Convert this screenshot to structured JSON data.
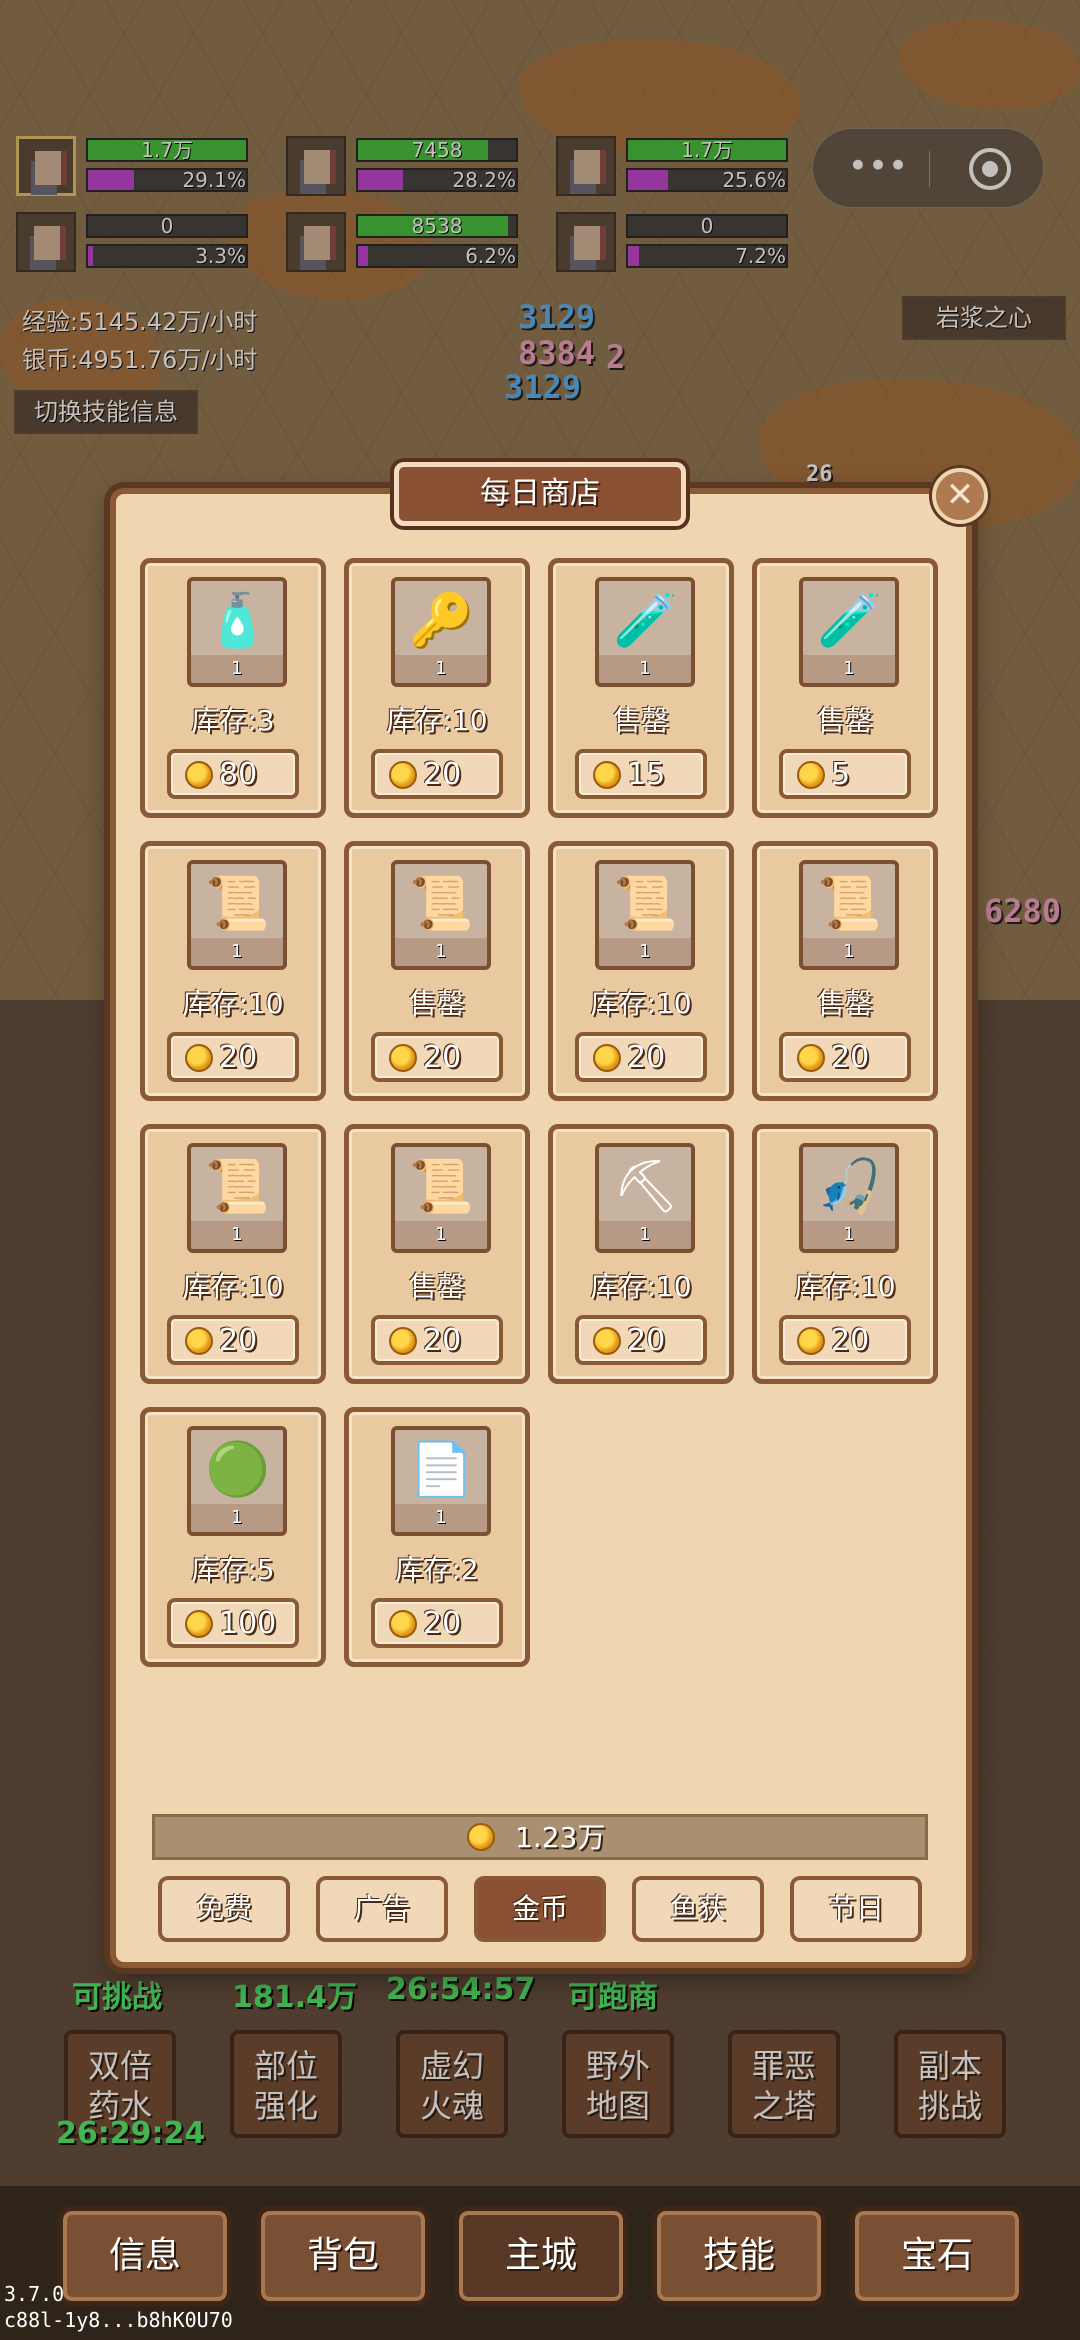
{
  "capsule": {
    "more_icon": "more-dots-icon",
    "dots": "•••",
    "target_icon": "target-icon"
  },
  "heroes": [
    {
      "hp": "1.7万",
      "hp_fraction": 1.0,
      "xp": "29.1%",
      "xp_fraction": 0.291,
      "selected": true
    },
    {
      "hp": "7458",
      "hp_fraction": 0.82,
      "xp": "28.2%",
      "xp_fraction": 0.282,
      "selected": false
    },
    {
      "hp": "1.7万",
      "hp_fraction": 1.0,
      "xp": "25.6%",
      "xp_fraction": 0.256,
      "selected": false
    },
    {
      "hp": "0",
      "hp_fraction": 0.0,
      "xp": "3.3%",
      "xp_fraction": 0.033,
      "selected": false
    },
    {
      "hp": "8538",
      "hp_fraction": 0.95,
      "xp": "6.2%",
      "xp_fraction": 0.062,
      "selected": false
    },
    {
      "hp": "0",
      "hp_fraction": 0.0,
      "xp": "7.2%",
      "xp_fraction": 0.072,
      "selected": false
    }
  ],
  "stats": {
    "exp_rate": "经验:5145.42万/小时",
    "silver_rate": "银币:4951.76万/小时"
  },
  "hud": {
    "switch_skill_info": "切换技能信息",
    "zone_name": "岩浆之心"
  },
  "damage_numbers": [
    "3129",
    "8384",
    "2",
    "3129",
    "6280",
    "26"
  ],
  "background": {
    "timers": [
      "可挑战",
      "181.4万",
      "26:54:57",
      "可跑商",
      "26:29:24"
    ],
    "bottom_buttons": [
      {
        "label_1": "双倍",
        "label_2": "药水"
      },
      {
        "label_1": "部位",
        "label_2": "强化"
      },
      {
        "label_1": "虚幻",
        "label_2": "火魂"
      },
      {
        "label_1": "野外",
        "label_2": "地图"
      },
      {
        "label_1": "罪恶",
        "label_2": "之塔"
      },
      {
        "label_1": "副本",
        "label_2": "挑战"
      }
    ]
  },
  "shop": {
    "title": "每日商店",
    "close_icon": "close-icon",
    "items": [
      {
        "icon": "bottle-cross-icon",
        "glyph": "🧴",
        "count": "1",
        "stock": "库存:3",
        "price": "80"
      },
      {
        "icon": "key-icon",
        "glyph": "🔑",
        "count": "1",
        "stock": "库存:10",
        "price": "20"
      },
      {
        "icon": "orange-potion-icon",
        "glyph": "🧪",
        "count": "1",
        "stock": "售罄",
        "price": "15"
      },
      {
        "icon": "green-potion-icon",
        "glyph": "🧪",
        "count": "1",
        "stock": "售罄",
        "price": "5"
      },
      {
        "icon": "scroll-teal-ribbon-icon",
        "glyph": "📜",
        "count": "1",
        "stock": "库存:10",
        "price": "20"
      },
      {
        "icon": "scroll-red-ribbon-icon",
        "glyph": "📜",
        "count": "1",
        "stock": "售罄",
        "price": "20"
      },
      {
        "icon": "scroll-gold-ribbon-icon",
        "glyph": "📜",
        "count": "1",
        "stock": "库存:10",
        "price": "20"
      },
      {
        "icon": "scroll-blue-ribbon-icon",
        "glyph": "📜",
        "count": "1",
        "stock": "售罄",
        "price": "20"
      },
      {
        "icon": "scroll-crimson-ribbon-icon",
        "glyph": "📜",
        "count": "1",
        "stock": "库存:10",
        "price": "20"
      },
      {
        "icon": "rolled-scroll-icon",
        "glyph": "📜",
        "count": "1",
        "stock": "售罄",
        "price": "20"
      },
      {
        "icon": "pickaxe-icon",
        "glyph": "⛏",
        "count": "1",
        "stock": "库存:10",
        "price": "20"
      },
      {
        "icon": "fishing-rod-icon",
        "glyph": "🎣",
        "count": "1",
        "stock": "库存:10",
        "price": "20"
      },
      {
        "icon": "green-eye-orb-icon",
        "glyph": "🟢",
        "count": "1",
        "stock": "库存:5",
        "price": "100"
      },
      {
        "icon": "paper-scroll-icon",
        "glyph": "📄",
        "count": "1",
        "stock": "库存:2",
        "price": "20"
      }
    ],
    "balance": "1.23万",
    "tabs": [
      "免费",
      "广告",
      "金币",
      "鱼获",
      "节日"
    ],
    "active_tab": "金币"
  },
  "nav": {
    "tabs": [
      "信息",
      "背包",
      "主城",
      "技能",
      "宝石"
    ],
    "active": "主城"
  },
  "footer": {
    "version": "3.7.0",
    "device_id": "c88l-1y8...b8hK0U70"
  },
  "colors": {
    "hp": "#3fbf3a",
    "xp": "#c040d0",
    "modal_bg": "#f0d6b0",
    "frame": "#8a5a36",
    "timer_green": "#4df06a"
  }
}
